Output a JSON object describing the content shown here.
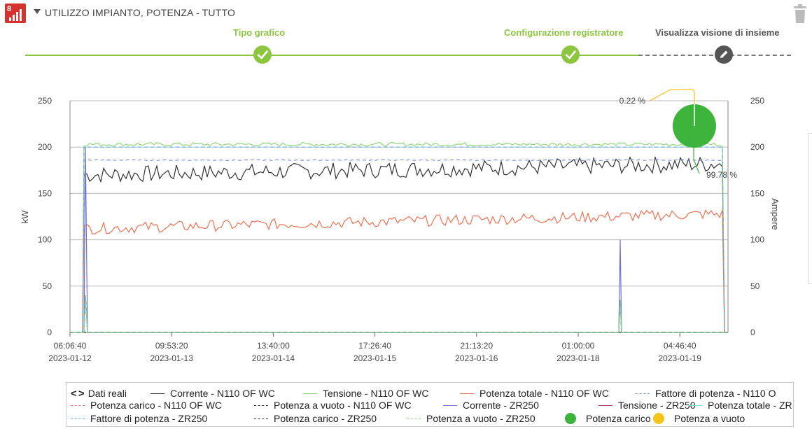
{
  "header": {
    "title": "UTILIZZO IMPIANTO, POTENZA - TUTTO",
    "app_badge": "8",
    "icons": {
      "app": "chart-bars-icon",
      "collapse": "chevron-down-icon",
      "delete": "trash-icon"
    }
  },
  "stepper": {
    "steps": [
      {
        "label": "Tipo grafico",
        "state": "done",
        "icon": "check-icon"
      },
      {
        "label": "Configurazione registratore",
        "state": "done",
        "icon": "check-icon"
      },
      {
        "label": "Visualizza visione di insieme",
        "state": "current",
        "icon": "pencil-icon"
      }
    ],
    "colors": {
      "done": "#8cc63e",
      "todo": "#555555"
    }
  },
  "chart_data": {
    "type": "line",
    "ylabel": "kW",
    "y2label": "Ampere",
    "ylim": [
      0,
      250
    ],
    "y2lim": [
      0,
      250
    ],
    "yticks": [
      "250",
      "200",
      "150",
      "100",
      "50",
      "0"
    ],
    "y2ticks": [
      "250",
      "200",
      "150",
      "100",
      "50",
      "0"
    ],
    "xticks": [
      {
        "time": "06:06:40",
        "date": "2023-01-12"
      },
      {
        "time": "09:53:20",
        "date": "2023-01-13"
      },
      {
        "time": "13:40:00",
        "date": "2023-01-14"
      },
      {
        "time": "17:26:40",
        "date": "2023-01-15"
      },
      {
        "time": "21:13:20",
        "date": "2023-01-16"
      },
      {
        "time": "01:00:00",
        "date": "2023-01-18"
      },
      {
        "time": "04:46:40",
        "date": "2023-01-19"
      }
    ],
    "grid": true,
    "series": [
      {
        "name": "Corrente - N110 OF WC",
        "color": "#333333",
        "style": "solid",
        "approx_level": 170,
        "variation": 18
      },
      {
        "name": "Tensione - N110 OF WC",
        "color": "#8fd67a",
        "style": "solid",
        "approx_level": 203,
        "variation": 4
      },
      {
        "name": "Potenza totale - N110 OF WC",
        "color": "#f07050",
        "style": "solid",
        "approx_level": 112,
        "variation": 12
      },
      {
        "name": "Fattore di potenza - N110 O",
        "color": "#7a8fe0",
        "style": "dashed",
        "approx_level": 186,
        "variation": 1
      },
      {
        "name": "Potenza carico - N110 OF WC",
        "color": "#e07070",
        "style": "dashed",
        "approx_level": 0,
        "variation": 0
      },
      {
        "name": "Potenza a vuoto - N110 OF WC",
        "color": "#333333",
        "style": "dashed",
        "approx_level": 0,
        "variation": 0
      },
      {
        "name": "Corrente - ZR250",
        "color": "#7070d0",
        "style": "solid",
        "approx_level": 0,
        "variation": 0
      },
      {
        "name": "Tensione - ZR250",
        "color": "#9a3a7a",
        "style": "solid",
        "approx_level": 0,
        "variation": 0
      },
      {
        "name": "Potenza totale - ZR",
        "color": "#7fe0d0",
        "style": "solid",
        "approx_level": 0,
        "variation": 0
      },
      {
        "name": "Fattore di potenza - ZR250",
        "color": "#5ab0e0",
        "style": "dashed",
        "approx_level": 200,
        "variation": 0
      },
      {
        "name": "Potenza carico - ZR250",
        "color": "#333333",
        "style": "dashed",
        "approx_level": 0,
        "variation": 0
      },
      {
        "name": "Potenza a vuoto - ZR250",
        "color": "#8fd67a",
        "style": "dashed",
        "approx_level": 0,
        "variation": 0
      }
    ],
    "pie": {
      "slices": [
        {
          "name": "Potenza carico",
          "value": 99.78,
          "label": "99.78 %",
          "color": "#3cb43c"
        },
        {
          "name": "Potenza a vuoto",
          "value": 0.22,
          "label": "0.22 %",
          "color": "#f5c518"
        }
      ]
    }
  },
  "legend": {
    "nav_label": "Dati reali",
    "items": [
      {
        "label": "Corrente - N110 OF WC",
        "color": "#333333",
        "style": "solid"
      },
      {
        "label": "Tensione - N110 OF WC",
        "color": "#8fd67a",
        "style": "solid"
      },
      {
        "label": "Potenza totale - N110 OF WC",
        "color": "#f07050",
        "style": "solid"
      },
      {
        "label": "Fattore di potenza - N110 O",
        "color": "#7a8fe0",
        "style": "dashed"
      },
      {
        "label": "Potenza carico - N110 OF WC",
        "color": "#e07070",
        "style": "dashed"
      },
      {
        "label": "Potenza a vuoto - N110 OF WC",
        "color": "#333333",
        "style": "dashed"
      },
      {
        "label": "Corrente - ZR250",
        "color": "#7070d0",
        "style": "solid"
      },
      {
        "label": "Tensione - ZR250",
        "color": "#9a3a7a",
        "style": "solid"
      },
      {
        "label": "Potenza totale - ZR",
        "color": "#7fe0d0",
        "style": "solid"
      },
      {
        "label": "Fattore di potenza - ZR250",
        "color": "#5ab0e0",
        "style": "dashed"
      },
      {
        "label": "Potenza carico - ZR250",
        "color": "#333333",
        "style": "dashed"
      },
      {
        "label": "Potenza a vuoto - ZR250",
        "color": "#8fd67a",
        "style": "dashed"
      },
      {
        "label": "Potenza carico",
        "color": "#3cb43c",
        "style": "dot"
      },
      {
        "label": "Potenza a vuoto",
        "color": "#f5c518",
        "style": "dot"
      }
    ]
  }
}
